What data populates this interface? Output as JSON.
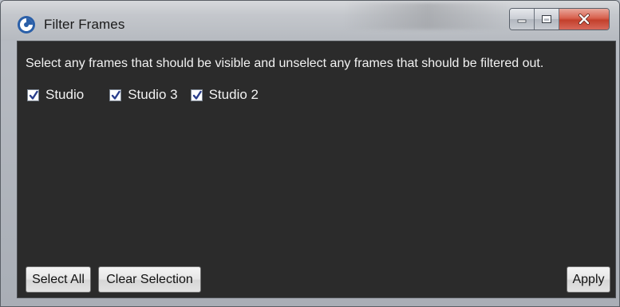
{
  "window": {
    "title": "Filter Frames",
    "icon": "app-logo-icon"
  },
  "caption_buttons": {
    "minimize": "minimize-icon",
    "maximize": "maximize-icon",
    "close": "close-icon"
  },
  "instruction": "Select any frames that should be visible and unselect any frames that should be filtered out.",
  "frames": [
    {
      "label": "Studio",
      "checked": true
    },
    {
      "label": "Studio 3",
      "checked": true
    },
    {
      "label": "Studio 2",
      "checked": true
    }
  ],
  "buttons": {
    "select_all": "Select All",
    "clear_selection": "Clear Selection",
    "apply": "Apply"
  },
  "colors": {
    "client_bg": "#2b2b2b",
    "text": "#f2f2f2",
    "close_red": "#c3402c"
  }
}
